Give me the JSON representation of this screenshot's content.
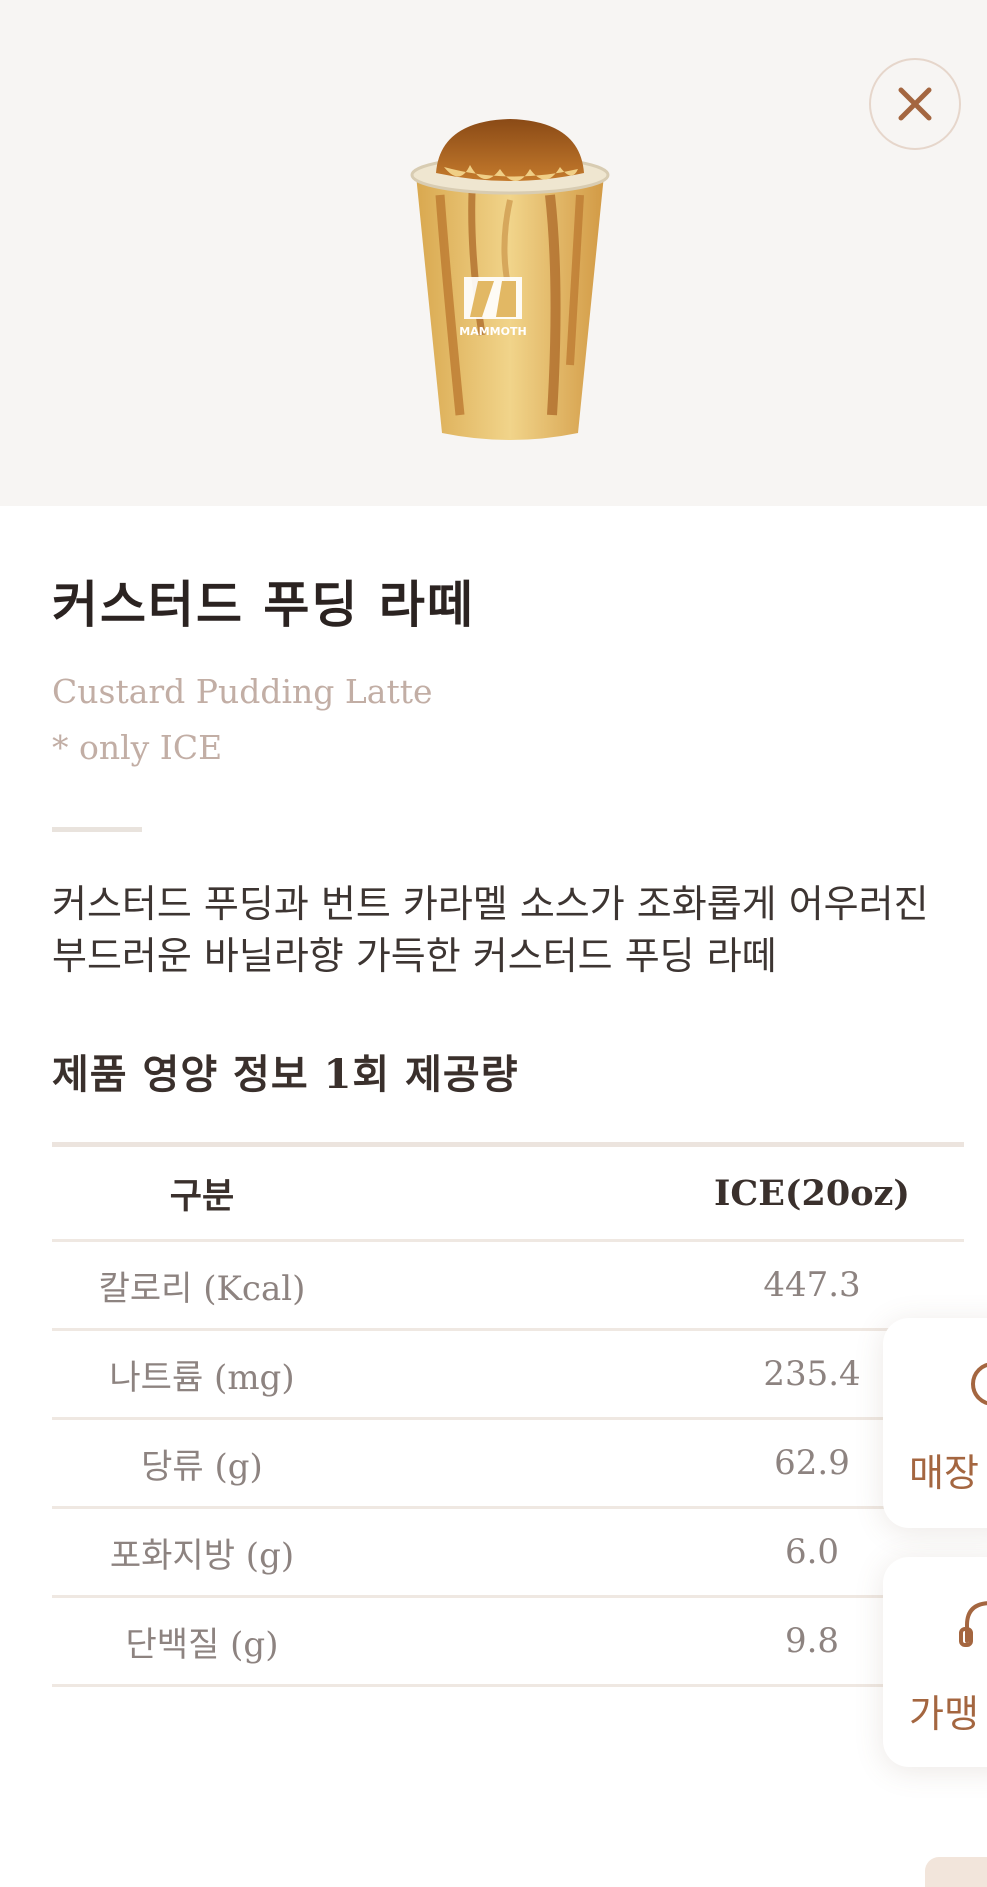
{
  "product": {
    "name_ko": "커스터드 푸딩 라떼",
    "name_en": "Custard Pudding Latte",
    "note": "* only ICE",
    "description_lines": [
      "커스터드 푸딩과 번트 카라멜 소스가 조화롭게 어우러진",
      "부드러운 바닐라향 가득한 커스터드 푸딩 라떼"
    ],
    "image_icon": "pudding-latte-cup",
    "cup_logo_text": "MAMMOTH"
  },
  "nutrition": {
    "title": "제품 영양 정보 1회 제공량",
    "headers": [
      "구분",
      "ICE(20oz)"
    ],
    "rows": [
      [
        "칼로리 (Kcal)",
        "447.3"
      ],
      [
        "나트륨 (mg)",
        "235.4"
      ],
      [
        "당류 (g)",
        "62.9"
      ],
      [
        "포화지방 (g)",
        "6.0"
      ],
      [
        "단백질 (g)",
        "9.8"
      ]
    ]
  },
  "side_buttons": [
    {
      "label": "매장",
      "icon": "search-icon"
    },
    {
      "label": "가맹",
      "icon": "headset-icon"
    }
  ],
  "colors": {
    "hero_bg": "#f7f5f3",
    "accent": "#a46640",
    "subtitle": "#c2aea5",
    "close_ring": "#e6d6cb",
    "close_x": "#a46640",
    "table_rule": "#efe8e2"
  }
}
